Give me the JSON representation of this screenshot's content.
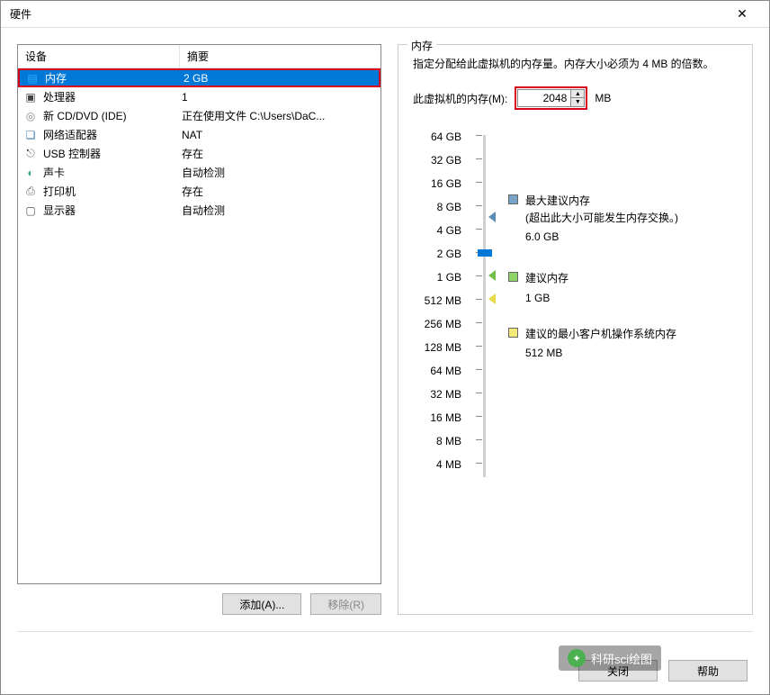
{
  "window": {
    "title": "硬件"
  },
  "deviceList": {
    "headers": {
      "device": "设备",
      "summary": "摘要"
    },
    "rows": [
      {
        "icon": "memory-icon",
        "name": "内存",
        "summary": "2 GB",
        "selected": true
      },
      {
        "icon": "cpu-icon",
        "name": "处理器",
        "summary": "1"
      },
      {
        "icon": "cd-icon",
        "name": "新 CD/DVD (IDE)",
        "summary": "正在使用文件 C:\\Users\\DaC..."
      },
      {
        "icon": "network-icon",
        "name": "网络适配器",
        "summary": "NAT"
      },
      {
        "icon": "usb-icon",
        "name": "USB 控制器",
        "summary": "存在"
      },
      {
        "icon": "sound-icon",
        "name": "声卡",
        "summary": "自动检测"
      },
      {
        "icon": "printer-icon",
        "name": "打印机",
        "summary": "存在"
      },
      {
        "icon": "display-icon",
        "name": "显示器",
        "summary": "自动检测"
      }
    ]
  },
  "buttons": {
    "add": "添加(A)...",
    "remove": "移除(R)",
    "close": "关闭",
    "help": "帮助"
  },
  "memoryPanel": {
    "title": "内存",
    "description": "指定分配给此虚拟机的内存量。内存大小必须为 4 MB 的倍数。",
    "inputLabel": "此虚拟机的内存(M):",
    "inputValue": "2048",
    "unit": "MB",
    "ticks": [
      "64 GB",
      "32 GB",
      "16 GB",
      "8 GB",
      "4 GB",
      "2 GB",
      "1 GB",
      "512 MB",
      "256 MB",
      "128 MB",
      "64 MB",
      "32 MB",
      "16 MB",
      "8 MB",
      "4 MB"
    ],
    "thumbIndex": 5,
    "markers": {
      "max": {
        "index": 3.5,
        "color": "blue"
      },
      "rec": {
        "index": 6,
        "color": "green"
      },
      "min": {
        "index": 7,
        "color": "yellow"
      }
    },
    "legend": {
      "max": {
        "title": "最大建议内存",
        "note": "(超出此大小可能发生内存交换。)",
        "value": "6.0 GB"
      },
      "rec": {
        "title": "建议内存",
        "value": "1 GB"
      },
      "min": {
        "title": "建议的最小客户机操作系统内存",
        "value": "512 MB"
      }
    }
  },
  "watermark": {
    "text": "科研sci绘图"
  }
}
